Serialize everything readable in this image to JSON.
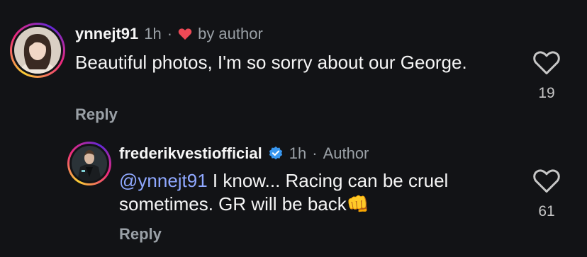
{
  "comments": [
    {
      "username": "ynnejt91",
      "time": "1h",
      "separator": "·",
      "author_like": "by author",
      "text": "Beautiful photos, I'm so sorry about our George.",
      "reply_label": "Reply",
      "likes": "19",
      "avatar_icon": "avatar-photo"
    },
    {
      "username": "frederikvestiofficial",
      "verified": true,
      "time": "1h",
      "separator": "·",
      "role": "Author",
      "mention": "@ynnejt91",
      "text_line1": " I know... Racing can be cruel",
      "text_line2": "sometimes. GR will be back",
      "emoji": "👊",
      "reply_label": "Reply",
      "likes": "61",
      "avatar_icon": "avatar-photo"
    }
  ],
  "colors": {
    "background": "#121316",
    "heart_red": "#ed4956",
    "verified_blue": "#3897f0",
    "mention": "#8fa8ff",
    "meta_gray": "#9aa0a6"
  }
}
